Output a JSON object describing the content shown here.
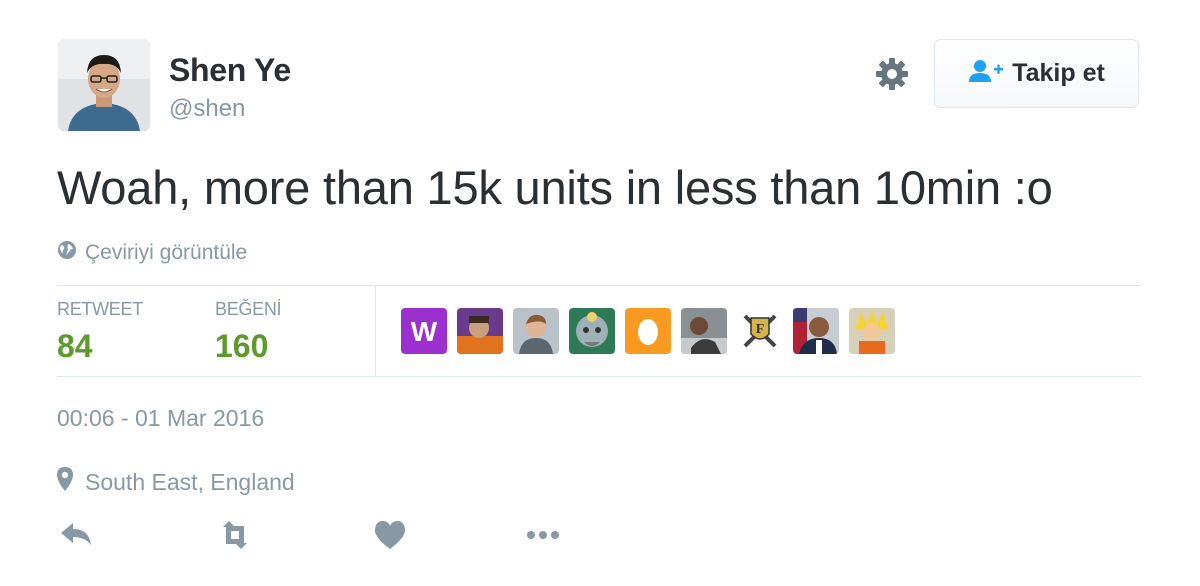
{
  "author": {
    "name": "Shen Ye",
    "handle": "@shen"
  },
  "follow_button": {
    "label": "Takip et",
    "icon": "add-user-icon"
  },
  "settings_icon": "gear-icon",
  "tweet": {
    "text": "Woah, more than 15k units in less than 10min :o",
    "translate_label": "Çeviriyi görüntüle",
    "translate_icon": "globe-icon"
  },
  "stats": {
    "retweets": {
      "label": "RETWEET",
      "count": "84"
    },
    "likes": {
      "label": "BEĞENİ",
      "count": "160"
    }
  },
  "likers": [
    {
      "icon": "purple-w-logo-avatar"
    },
    {
      "icon": "user-photo-avatar"
    },
    {
      "icon": "user-photo-avatar"
    },
    {
      "icon": "user-photo-avatar"
    },
    {
      "icon": "default-egg-avatar"
    },
    {
      "icon": "user-photo-avatar"
    },
    {
      "icon": "crest-logo-avatar"
    },
    {
      "icon": "user-photo-avatar"
    },
    {
      "icon": "cartoon-avatar"
    }
  ],
  "timestamp": "00:06 - 01 Mar 2016",
  "location": {
    "text": "South East, England",
    "icon": "map-pin-icon"
  },
  "actions": [
    "reply-icon",
    "retweet-icon",
    "like-icon",
    "more-icon"
  ],
  "colors": {
    "text": "#292f33",
    "muted": "#8899a6",
    "accent_blue": "#1da1f2",
    "count_green": "#5b9a2b",
    "border": "#e1e8ed"
  }
}
